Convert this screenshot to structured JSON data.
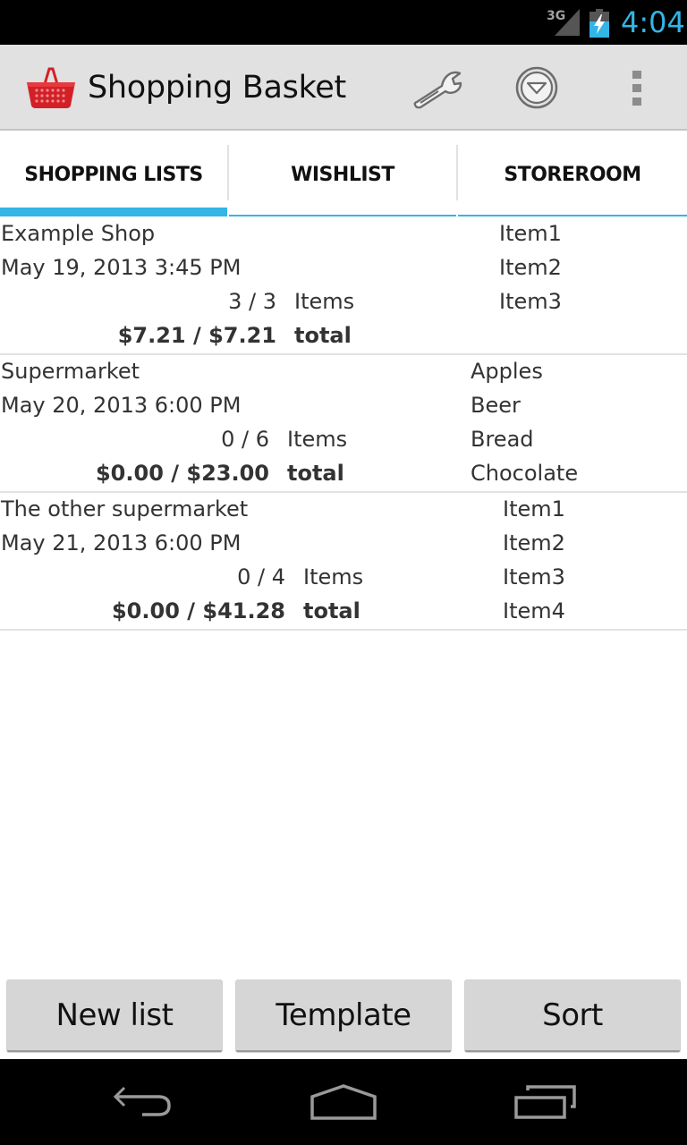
{
  "status_bar": {
    "network": "3G",
    "time": "4:04",
    "icons": [
      "signal-icon",
      "battery-charging-icon"
    ]
  },
  "action_bar": {
    "title": "Shopping Basket",
    "icons": [
      "basket-logo-icon",
      "wrench-icon",
      "filter-icon",
      "overflow-menu-icon"
    ]
  },
  "tabs": [
    {
      "label": "SHOPPING LISTS",
      "active": true
    },
    {
      "label": "WISHLIST",
      "active": false
    },
    {
      "label": "STOREROOM",
      "active": false
    }
  ],
  "lists": [
    {
      "name": "Example Shop",
      "date": "May 19, 2013 3:45 PM",
      "count": "3 / 3",
      "items_label": "Items",
      "total": "$7.21 / $7.21",
      "total_label": "total",
      "items": [
        "Item1",
        "Item2",
        "Item3"
      ]
    },
    {
      "name": "Supermarket",
      "date": "May 20, 2013 6:00 PM",
      "count": "0 / 6",
      "items_label": "Items",
      "total": "$0.00 / $23.00",
      "total_label": "total",
      "items": [
        "Apples",
        "Beer",
        "Bread",
        "Chocolate"
      ]
    },
    {
      "name": "The other supermarket",
      "date": "May 21, 2013 6:00 PM",
      "count": "0 / 4",
      "items_label": "Items",
      "total": "$0.00 / $41.28",
      "total_label": "total",
      "items": [
        "Item1",
        "Item2",
        "Item3",
        "Item4"
      ]
    }
  ],
  "buttons": {
    "new_list": "New list",
    "template": "Template",
    "sort": "Sort"
  },
  "nav_bar": {
    "icons": [
      "back-icon",
      "home-icon",
      "recent-apps-icon"
    ]
  },
  "colors": {
    "accent": "#33b5e5",
    "action_bar_bg": "#e1e1e1",
    "button_bg": "#d6d6d6",
    "logo_red": "#d32027"
  }
}
